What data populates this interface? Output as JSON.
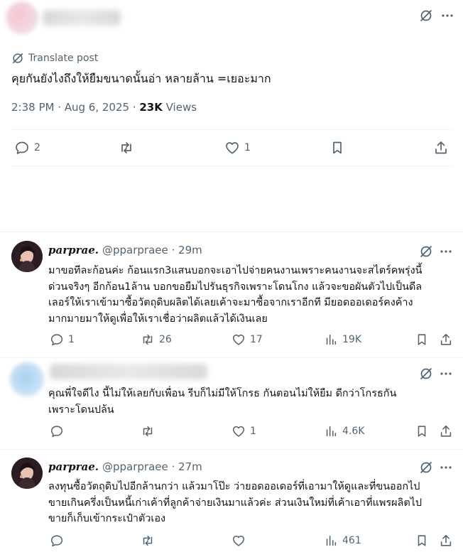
{
  "main_post": {
    "translate_label": "Translate post",
    "text": "คุยกันยังไงถึงให้ยืมขนาดนั้นอ่า หลายล้าน =เยอะมาก",
    "time": "2:38 PM · Aug 6, 2025 · ",
    "views_count": "23K",
    "views_label": " Views",
    "replies": "2",
    "likes": "1"
  },
  "replies": [
    {
      "name": "parprae.",
      "handle": "@pparpraee · 29m",
      "text": "มาขอทีละก้อนค่ะ ก้อนแรก3แสนบอกจะเอาไปจ่ายคนงานเพราะคนงานจะสไตร์คพรุ่งนี้\nด่วนจริงๆ อีกก้อน1ล้าน บอกขอยืมไปรันธุรกิจเพราะโดนโกง แล้วจะขอผันตัวไปเป็นดีล\nเลอร์ให้เราเข้ามาซื้อวัตถุดิบผลิตได้เลยเค้าจะมาซื้อจากเราอีกที มียอดออเดอร์คงค้าง\nมากมายมาให้ดูเพื่อให้เราเชื่อว่าผลิตแล้วได้เงินเลย",
      "replies": "1",
      "reposts": "26",
      "likes": "17",
      "views": "19K"
    },
    {
      "text": "คุณพี่ใจดีไง นี้ไม่ให้เลยกับเพื่อน รีบก็ไม่มีให้โกรธ กันตอนไม่ให้ยืม ดีกว่าโกรธกัน\nเพราะโดนปล้น",
      "likes": "1",
      "views": "4.6K"
    },
    {
      "name": "parprae.",
      "handle": "@pparpraee · 27m",
      "text": "ลงทุนซื้อวัตถุดิบไปอีกล้านกว่า แล้วมาโป๊ะ ว่ายอดออเดอร์ที่เอามาให้ดูและที่ขนออกไป\nขายเกินครึ่งเป็นหนี้เก่าเค้าที่ลูกค้าจ่ายเงินมาแล้วค่ะ ส่วนเงินใหม่ที่เค้าเอาที่แพรผลิตไป\nขายก็เก็บเข้ากระเป๋าตัวเอง",
      "views": "461"
    }
  ],
  "colors": {
    "text_primary": "#0f1419",
    "text_secondary": "#536471",
    "link": "#536471",
    "divider": "#eff3f4"
  }
}
